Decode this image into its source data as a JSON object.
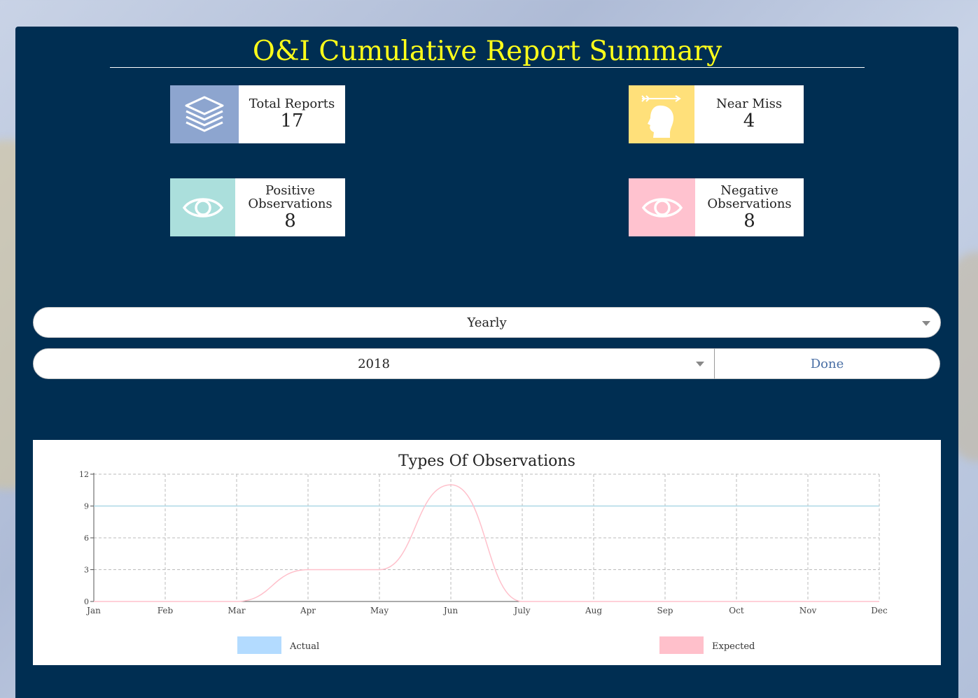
{
  "header": {
    "title": "O&I Cumulative Report Summary"
  },
  "cards": [
    {
      "label": "Total Reports",
      "value": "17",
      "icon": "stack-layers-icon",
      "color": "#8da5cf"
    },
    {
      "label": "Near Miss",
      "value": "4",
      "icon": "head-arrows-icon",
      "color": "#ffe07a"
    },
    {
      "label": "Positive Observations",
      "value": "8",
      "icon": "eye-icon",
      "color": "#abdfdc"
    },
    {
      "label": "Negative Observations",
      "value": "8",
      "icon": "eye-icon",
      "color": "#ffc2cf"
    }
  ],
  "filters": {
    "period": "Yearly",
    "year": "2018",
    "done_label": "Done"
  },
  "chart_data": {
    "type": "line",
    "title": "Types Of Observations",
    "categories": [
      "Jan",
      "Feb",
      "Mar",
      "Apr",
      "May",
      "Jun",
      "July",
      "Aug",
      "Sep",
      "Oct",
      "Nov",
      "Dec"
    ],
    "yticks": [
      0,
      3,
      6,
      9,
      12
    ],
    "ylim": [
      0,
      12
    ],
    "grid": true,
    "legend_position": "bottom",
    "series": [
      {
        "name": "Actual",
        "color": "#add8e6",
        "values": [
          9,
          9,
          9,
          9,
          9,
          9,
          9,
          9,
          9,
          9,
          9,
          9
        ]
      },
      {
        "name": "Expected",
        "color": "#ffc0cb",
        "values": [
          0,
          0,
          0,
          3,
          3,
          11,
          0,
          0,
          0,
          0,
          0,
          0
        ]
      }
    ]
  },
  "legend_colors": {
    "Actual": "#b3dbff",
    "Expected": "#ffc0cb"
  }
}
